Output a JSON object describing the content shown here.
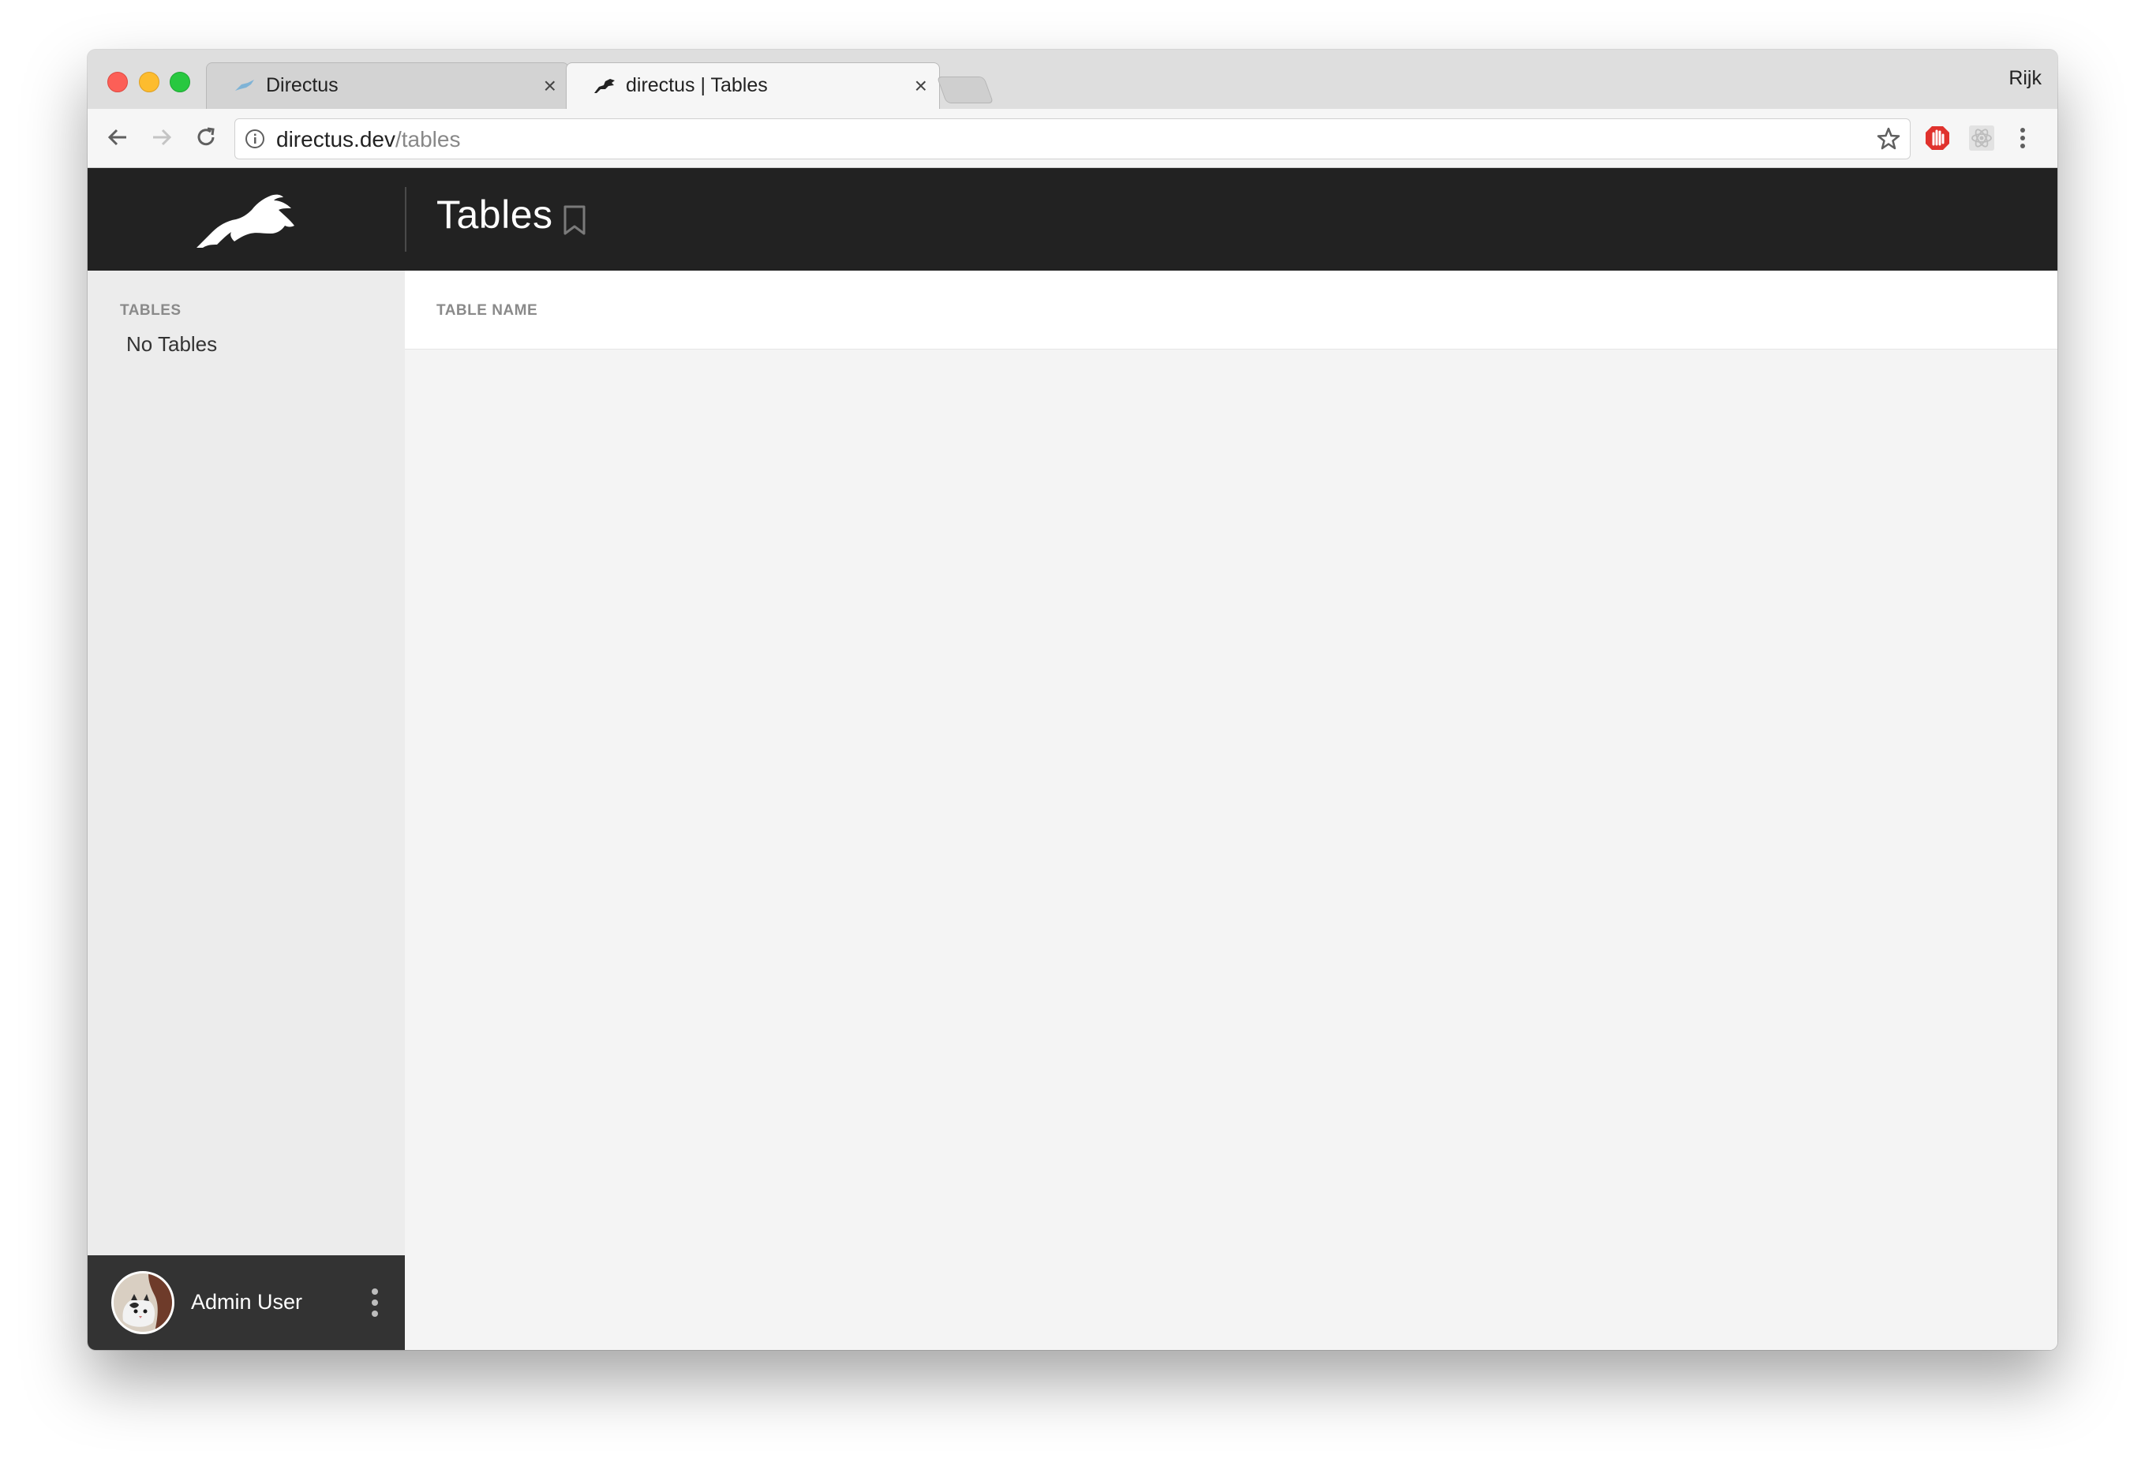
{
  "browser": {
    "tabs": [
      {
        "title": "Directus",
        "close": "×"
      },
      {
        "title": "directus | Tables",
        "close": "×"
      }
    ],
    "profile": "Rijk",
    "url": {
      "host": "directus.dev",
      "path": "/tables"
    }
  },
  "app": {
    "page_title": "Tables",
    "sidebar": {
      "section_label": "TABLES",
      "empty_text": "No Tables"
    },
    "table": {
      "column_header": "TABLE NAME"
    },
    "user": {
      "name": "Admin User"
    }
  },
  "colors": {
    "header_bg": "#222222",
    "sidebar_bg": "#ececec",
    "userbar_bg": "#333333",
    "content_bg": "#f4f4f4"
  }
}
